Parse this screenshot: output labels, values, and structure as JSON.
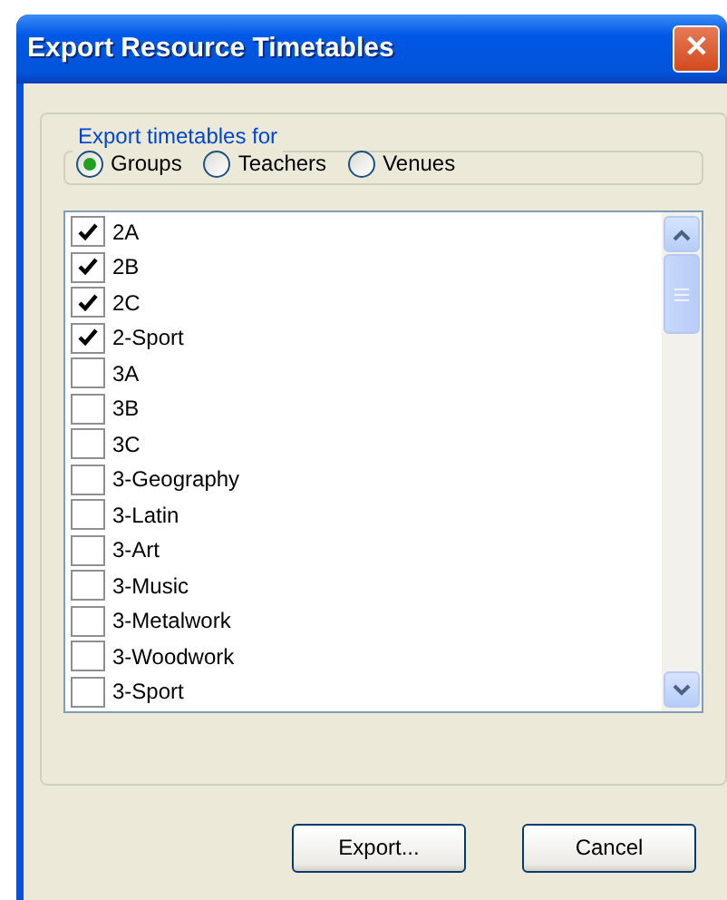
{
  "window": {
    "title": "Export Resource Timetables",
    "close": "✕"
  },
  "export_for": {
    "legend": "Export timetables for",
    "options": [
      {
        "label": "Groups",
        "selected": true
      },
      {
        "label": "Teachers",
        "selected": false
      },
      {
        "label": "Venues",
        "selected": false
      }
    ]
  },
  "items": [
    {
      "label": "2A",
      "checked": true
    },
    {
      "label": "2B",
      "checked": true
    },
    {
      "label": "2C",
      "checked": true
    },
    {
      "label": "2-Sport",
      "checked": true
    },
    {
      "label": "3A",
      "checked": false
    },
    {
      "label": "3B",
      "checked": false
    },
    {
      "label": "3C",
      "checked": false
    },
    {
      "label": "3-Geography",
      "checked": false
    },
    {
      "label": "3-Latin",
      "checked": false
    },
    {
      "label": "3-Art",
      "checked": false
    },
    {
      "label": "3-Music",
      "checked": false
    },
    {
      "label": "3-Metalwork",
      "checked": false
    },
    {
      "label": "3-Woodwork",
      "checked": false
    },
    {
      "label": "3-Sport",
      "checked": false
    }
  ],
  "buttons": [
    "Export...",
    "Cancel"
  ]
}
